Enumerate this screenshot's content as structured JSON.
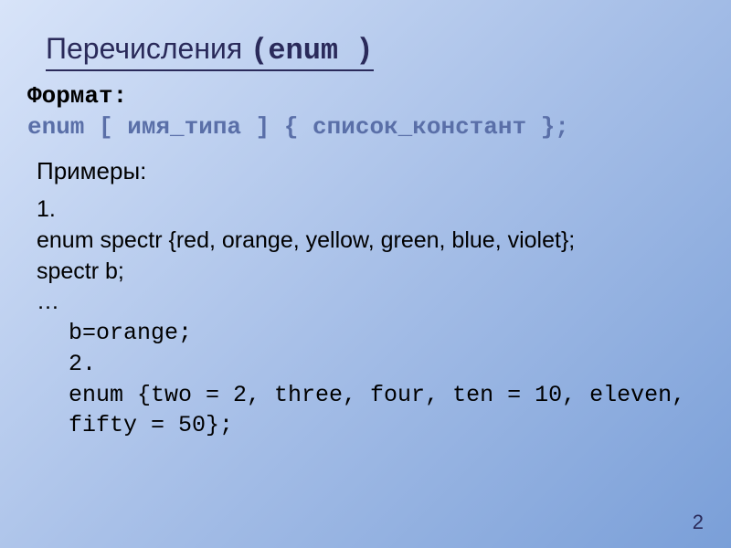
{
  "title": {
    "text": "Перечисления",
    "keyword": "enum"
  },
  "format": {
    "label": "Формат:",
    "syntax": "enum [ имя_типа ] { список_констант };"
  },
  "examples": {
    "label": "Примеры:",
    "ex1_num": "1.",
    "ex1_line1": "enum spectr {red, orange, yellow, green, blue, violet};",
    "ex1_line2": "spectr b;",
    "ex1_line3": "…",
    "ex1_line4": "b=orange;",
    "ex2_num": "2.",
    "ex2_line1": "enum {two = 2, three, four, ten = 10, eleven, fifty = 50};"
  },
  "page_number": "2"
}
